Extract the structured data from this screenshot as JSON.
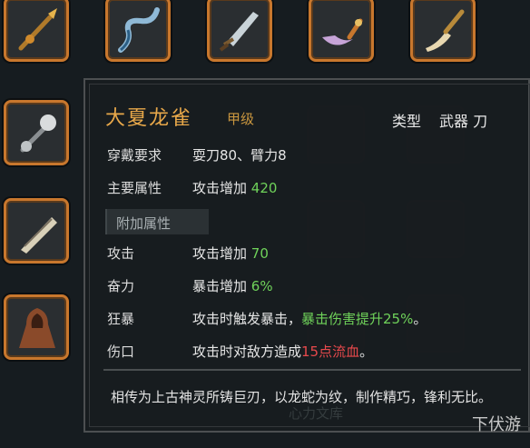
{
  "tooltip": {
    "name": "大夏龙雀",
    "grade": "甲级",
    "type_label": "类型",
    "type_value": "武器 刀",
    "requirement": {
      "label": "穿戴要求",
      "value": "耍刀80、臂力8"
    },
    "primary": {
      "label": "主要属性",
      "prefix": "攻击增加 ",
      "number": "420"
    },
    "extra_section": "附加属性",
    "attrs": [
      {
        "label": "攻击",
        "prefix": "攻击增加 ",
        "highlight": "70",
        "suffix": ""
      },
      {
        "label": "奋力",
        "prefix": "暴击增加 ",
        "highlight": "6%",
        "suffix": ""
      },
      {
        "label": "狂暴",
        "prefix": "攻击时触发暴击，",
        "highlight": "暴击伤害提升25%",
        "suffix": "。"
      },
      {
        "label": "伤口",
        "prefix": "攻击时对敌方造成",
        "highlight": "15点流血",
        "suffix": "。"
      }
    ],
    "description": "相传为上古神灵所铸巨刃，以龙蛇为纹，制作精巧，锋利无比。"
  },
  "watermarks": {
    "center": "心力文库",
    "corner": "下伏游"
  },
  "inventory": {
    "top_row": [
      "golden-spear-icon",
      "serpent-blade-icon",
      "broad-sword-icon",
      "crescent-blade-icon",
      "dragon-glaive-icon"
    ],
    "left_column": [
      "spiked-mace-icon",
      "bone-axe-icon",
      "hooded-cloak-icon"
    ]
  },
  "colors": {
    "slot_border": "#c8772d",
    "item_name": "#e8a84a",
    "green": "#6fd25a",
    "red": "#e8494c"
  }
}
